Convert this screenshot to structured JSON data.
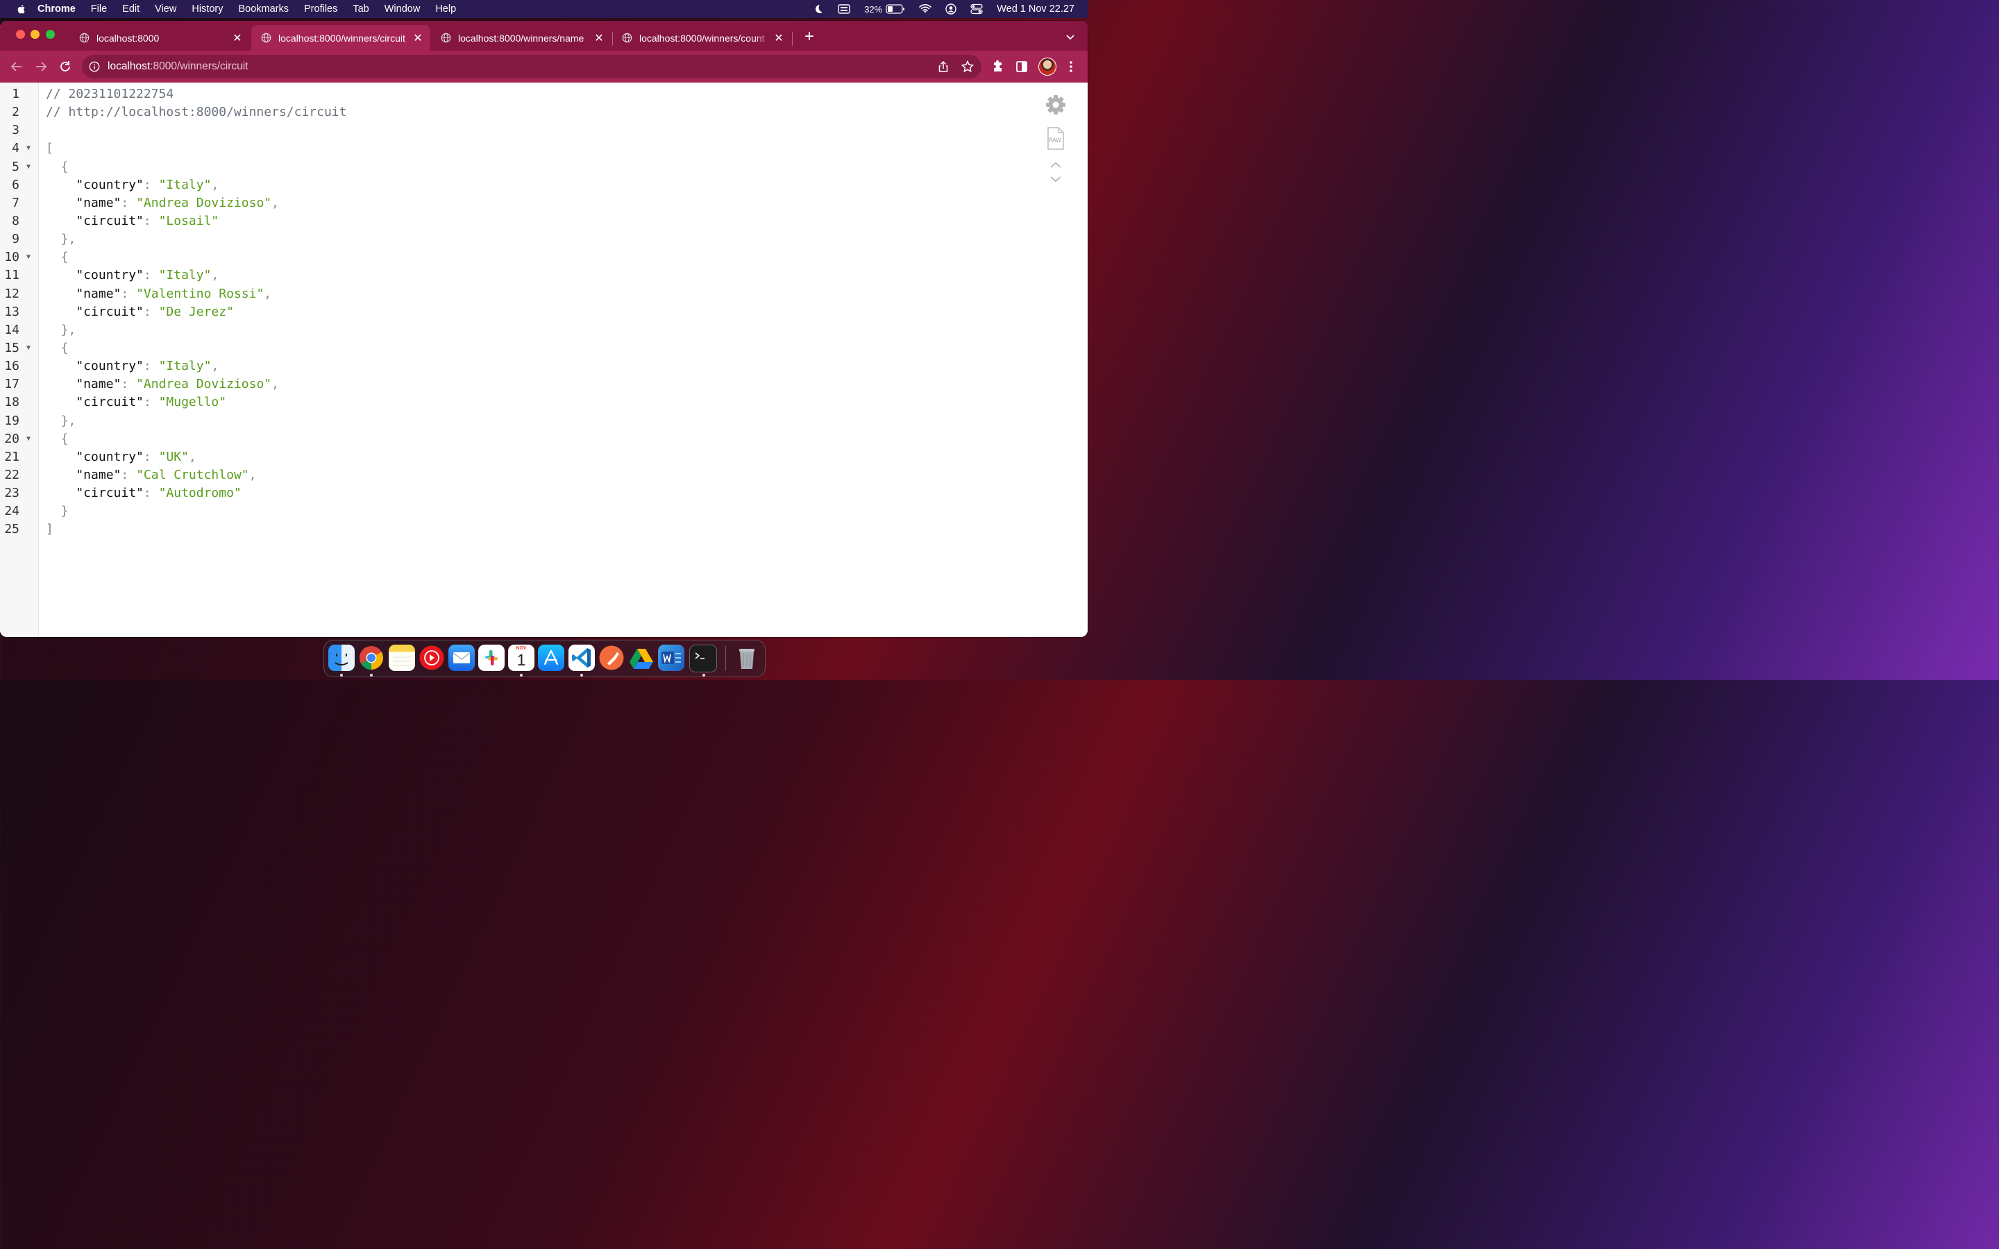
{
  "menubar": {
    "items": [
      "Chrome",
      "File",
      "Edit",
      "View",
      "History",
      "Bookmarks",
      "Profiles",
      "Tab",
      "Window",
      "Help"
    ],
    "battery": "32%",
    "clock": "Wed 1 Nov  22.27"
  },
  "tabs": [
    {
      "title": "localhost:8000",
      "active": false
    },
    {
      "title": "localhost:8000/winners/circuit",
      "active": true
    },
    {
      "title": "localhost:8000/winners/name",
      "active": false
    },
    {
      "title": "localhost:8000/winners/count",
      "active": false
    }
  ],
  "address_bar": {
    "host": "localhost",
    "rest": ":8000/winners/circuit"
  },
  "viewer": {
    "raw_label": "RAW",
    "lines": [
      {
        "n": "1",
        "fold": false,
        "parts": [
          [
            "cm",
            "// 20231101222754"
          ]
        ]
      },
      {
        "n": "2",
        "fold": false,
        "parts": [
          [
            "cm",
            "// http://localhost:8000/winners/circuit"
          ]
        ]
      },
      {
        "n": "3",
        "fold": false,
        "parts": []
      },
      {
        "n": "4",
        "fold": true,
        "parts": [
          [
            "p",
            "["
          ]
        ]
      },
      {
        "n": "5",
        "fold": true,
        "parts": [
          [
            "p",
            "  {"
          ]
        ]
      },
      {
        "n": "6",
        "fold": false,
        "parts": [
          [
            "k",
            "    \"country\""
          ],
          [
            "p",
            ": "
          ],
          [
            "s",
            "\"Italy\""
          ],
          [
            "p",
            ","
          ]
        ]
      },
      {
        "n": "7",
        "fold": false,
        "parts": [
          [
            "k",
            "    \"name\""
          ],
          [
            "p",
            ": "
          ],
          [
            "s",
            "\"Andrea Dovizioso\""
          ],
          [
            "p",
            ","
          ]
        ]
      },
      {
        "n": "8",
        "fold": false,
        "parts": [
          [
            "k",
            "    \"circuit\""
          ],
          [
            "p",
            ": "
          ],
          [
            "s",
            "\"Losail\""
          ]
        ]
      },
      {
        "n": "9",
        "fold": false,
        "parts": [
          [
            "p",
            "  },"
          ]
        ]
      },
      {
        "n": "10",
        "fold": true,
        "parts": [
          [
            "p",
            "  {"
          ]
        ]
      },
      {
        "n": "11",
        "fold": false,
        "parts": [
          [
            "k",
            "    \"country\""
          ],
          [
            "p",
            ": "
          ],
          [
            "s",
            "\"Italy\""
          ],
          [
            "p",
            ","
          ]
        ]
      },
      {
        "n": "12",
        "fold": false,
        "parts": [
          [
            "k",
            "    \"name\""
          ],
          [
            "p",
            ": "
          ],
          [
            "s",
            "\"Valentino Rossi\""
          ],
          [
            "p",
            ","
          ]
        ]
      },
      {
        "n": "13",
        "fold": false,
        "parts": [
          [
            "k",
            "    \"circuit\""
          ],
          [
            "p",
            ": "
          ],
          [
            "s",
            "\"De Jerez\""
          ]
        ]
      },
      {
        "n": "14",
        "fold": false,
        "parts": [
          [
            "p",
            "  },"
          ]
        ]
      },
      {
        "n": "15",
        "fold": true,
        "parts": [
          [
            "p",
            "  {"
          ]
        ]
      },
      {
        "n": "16",
        "fold": false,
        "parts": [
          [
            "k",
            "    \"country\""
          ],
          [
            "p",
            ": "
          ],
          [
            "s",
            "\"Italy\""
          ],
          [
            "p",
            ","
          ]
        ]
      },
      {
        "n": "17",
        "fold": false,
        "parts": [
          [
            "k",
            "    \"name\""
          ],
          [
            "p",
            ": "
          ],
          [
            "s",
            "\"Andrea Dovizioso\""
          ],
          [
            "p",
            ","
          ]
        ]
      },
      {
        "n": "18",
        "fold": false,
        "parts": [
          [
            "k",
            "    \"circuit\""
          ],
          [
            "p",
            ": "
          ],
          [
            "s",
            "\"Mugello\""
          ]
        ]
      },
      {
        "n": "19",
        "fold": false,
        "parts": [
          [
            "p",
            "  },"
          ]
        ]
      },
      {
        "n": "20",
        "fold": true,
        "parts": [
          [
            "p",
            "  {"
          ]
        ]
      },
      {
        "n": "21",
        "fold": false,
        "parts": [
          [
            "k",
            "    \"country\""
          ],
          [
            "p",
            ": "
          ],
          [
            "s",
            "\"UK\""
          ],
          [
            "p",
            ","
          ]
        ]
      },
      {
        "n": "22",
        "fold": false,
        "parts": [
          [
            "k",
            "    \"name\""
          ],
          [
            "p",
            ": "
          ],
          [
            "s",
            "\"Cal Crutchlow\""
          ],
          [
            "p",
            ","
          ]
        ]
      },
      {
        "n": "23",
        "fold": false,
        "parts": [
          [
            "k",
            "    \"circuit\""
          ],
          [
            "p",
            ": "
          ],
          [
            "s",
            "\"Autodromo\""
          ]
        ]
      },
      {
        "n": "24",
        "fold": false,
        "parts": [
          [
            "p",
            "  }"
          ]
        ]
      },
      {
        "n": "25",
        "fold": false,
        "parts": [
          [
            "p",
            "]"
          ]
        ]
      }
    ]
  },
  "dock": {
    "calendar_month": "NOV",
    "calendar_day": "1",
    "apps": [
      "finder-icon",
      "chrome-icon",
      "notes-icon",
      "youtube-music-icon",
      "mail-icon",
      "slack-icon",
      "calendar-icon",
      "app-store-icon",
      "vscode-icon",
      "postman-icon",
      "google-drive-icon",
      "word-icon",
      "terminal-icon",
      "trash-icon"
    ]
  },
  "colors": {
    "tabstrip": "#86153f",
    "toolbar": "#a52454",
    "json_string": "#5a9e1e",
    "json_key": "#111111",
    "menubar": "#2a1b52"
  }
}
